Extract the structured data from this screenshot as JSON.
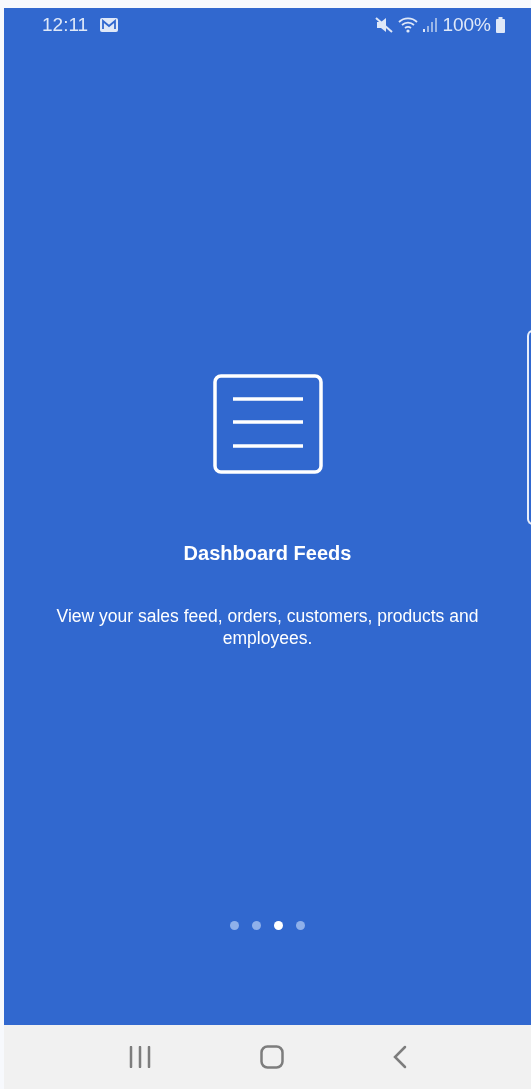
{
  "status_bar": {
    "time": "12:11",
    "battery": "100%"
  },
  "slide": {
    "title": "Dashboard Feeds",
    "description": "View your sales feed, orders, customers, products and employees."
  },
  "pager": [
    {
      "selected": false
    },
    {
      "selected": false
    },
    {
      "selected": true
    },
    {
      "selected": false
    }
  ]
}
